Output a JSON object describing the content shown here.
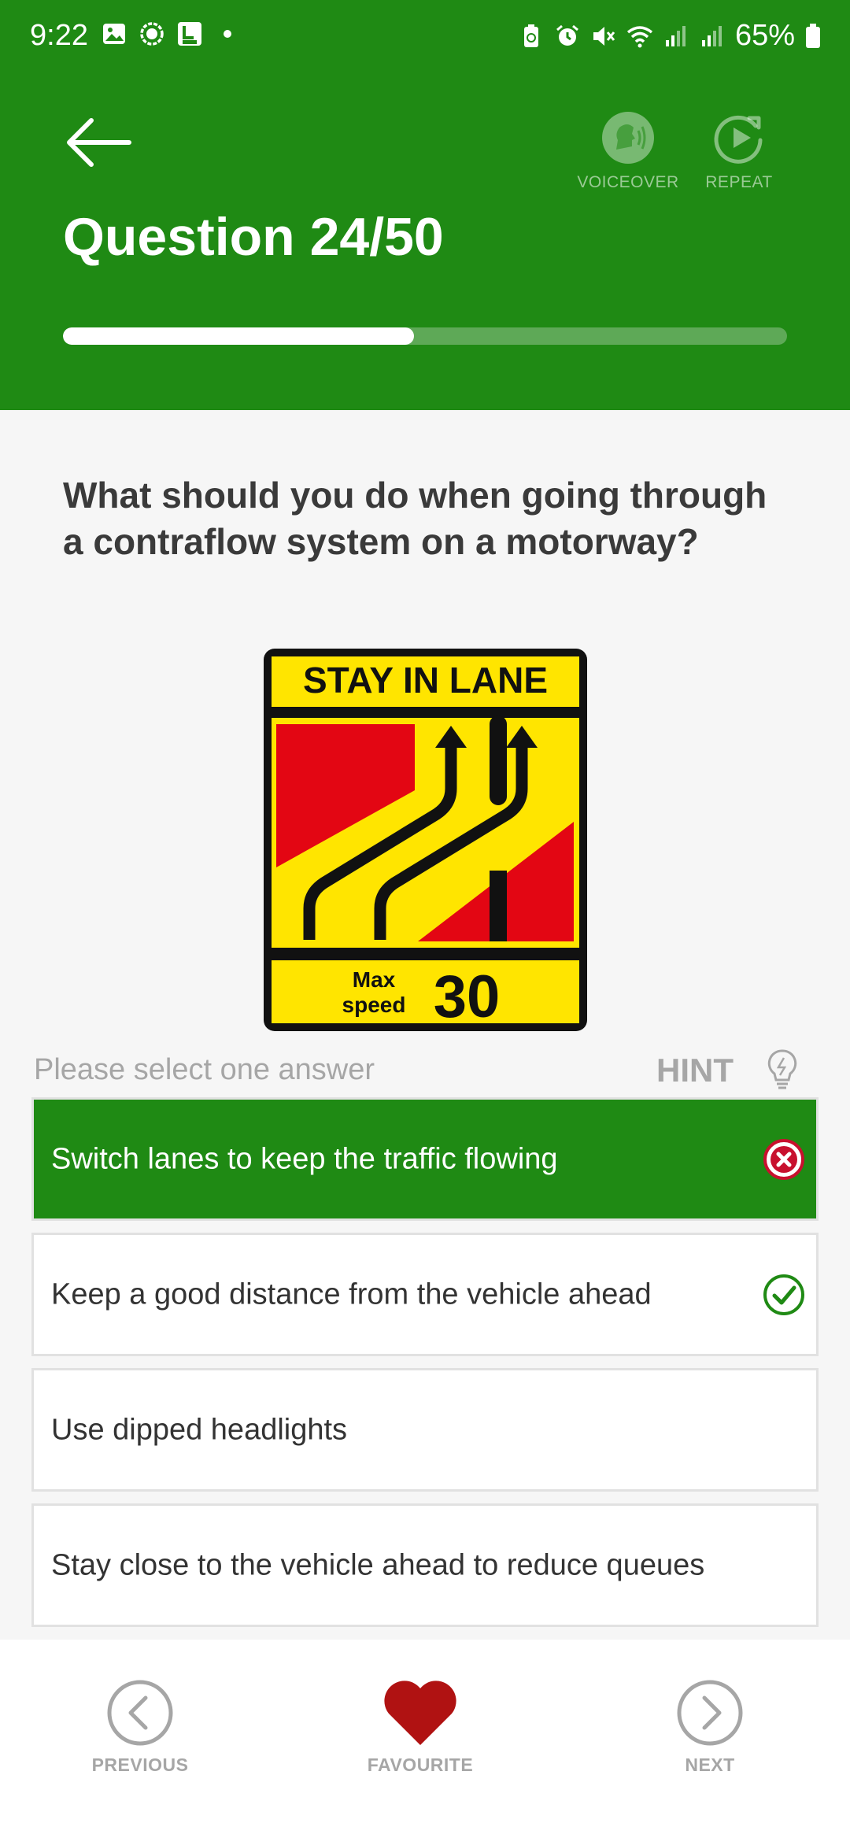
{
  "status_bar": {
    "time": "9:22",
    "battery": "65%"
  },
  "header": {
    "voiceover_label": "VOICEOVER",
    "repeat_label": "REPEAT",
    "question_counter": "Question 24/50",
    "progress": 0.485
  },
  "question": {
    "text": "What should you do when going through a contraflow system on a motorway?"
  },
  "sign": {
    "top_text": "STAY IN LANE",
    "max_label": "Max",
    "speed_label": "speed",
    "speed_value": "30"
  },
  "answers_section": {
    "prompt": "Please select one answer",
    "hint_label": "HINT"
  },
  "answers": [
    {
      "text": "Switch lanes to keep the traffic flowing",
      "state": "selected-wrong"
    },
    {
      "text": "Keep a good distance from the vehicle ahead",
      "state": "correct"
    },
    {
      "text": "Use dipped headlights",
      "state": "none"
    },
    {
      "text": "Stay close to the vehicle ahead to reduce queues",
      "state": "none"
    }
  ],
  "bottom_nav": {
    "previous_label": "PREVIOUS",
    "favourite_label": "FAVOURITE",
    "next_label": "NEXT"
  },
  "colors": {
    "brand_green": "#1f8a14",
    "wrong_red": "#c8102e",
    "favourite_red": "#b01212",
    "sign_yellow": "#ffe500",
    "sign_red": "#e30613"
  }
}
